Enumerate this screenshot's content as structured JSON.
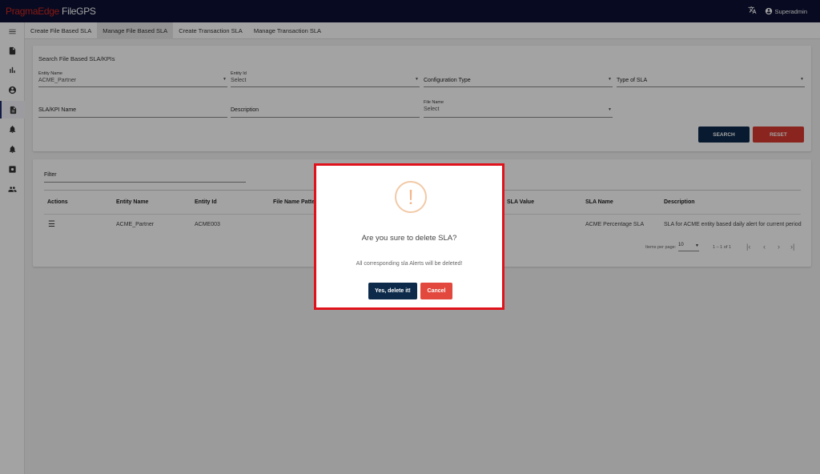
{
  "app": {
    "brand": "PragmaEdge",
    "product": "FileGPS",
    "user": "Superadmin"
  },
  "tabs": [
    {
      "label": "Create File Based SLA"
    },
    {
      "label": "Manage File Based SLA"
    },
    {
      "label": "Create Transaction SLA"
    },
    {
      "label": "Manage Transaction SLA"
    }
  ],
  "search": {
    "title": "Search File Based SLA/KPIs",
    "entity_name": {
      "label": "Entity Name",
      "value": "ACME_Partner"
    },
    "entity_id": {
      "label": "Entity Id",
      "value": "Select"
    },
    "configuration_type": {
      "placeholder": "Configuration Type"
    },
    "type_of_sla": {
      "placeholder": "Type of SLA"
    },
    "sla_kpi_name": {
      "placeholder": "SLA/KPI Name"
    },
    "description": {
      "placeholder": "Description"
    },
    "file_name": {
      "label": "File Name",
      "value": "Select"
    },
    "search_label": "SEARCH",
    "reset_label": "RESET"
  },
  "table": {
    "filter_placeholder": "Filter",
    "columns": [
      "Actions",
      "Entity Name",
      "Entity Id",
      "File Name Pattern",
      "SLA Value",
      "SLA Name",
      "Description"
    ],
    "rows": [
      {
        "entity_name": "ACME_Partner",
        "entity_id": "ACME003",
        "sla_name": "ACME Percentage SLA",
        "description": "SLA for ACME entity based daily alert for current period"
      }
    ],
    "pagination": {
      "items_per_page_label": "Items per page:",
      "items_per_page": "10",
      "range": "1 – 1 of 1"
    }
  },
  "dialog": {
    "icon": "!",
    "title": "Are you sure to delete SLA?",
    "text": "All corresponding sla Alerts will be deleted!",
    "confirm_label": "Yes, delete it!",
    "cancel_label": "Cancel"
  },
  "colors": {
    "topbar": "#0c1033",
    "brand": "#d6281f",
    "primary_button": "#0d2a4a",
    "danger_button": "#d63b30",
    "dialog_highlight": "#e0121c"
  },
  "icons": {
    "sidebar": [
      "menu-icon",
      "file-icon",
      "bar-chart-icon",
      "account-circle-icon",
      "document-icon",
      "bell-icon",
      "bell-icon",
      "settings-box-icon",
      "people-icon"
    ],
    "topbar": [
      "translate-icon",
      "account-circle-icon"
    ]
  }
}
